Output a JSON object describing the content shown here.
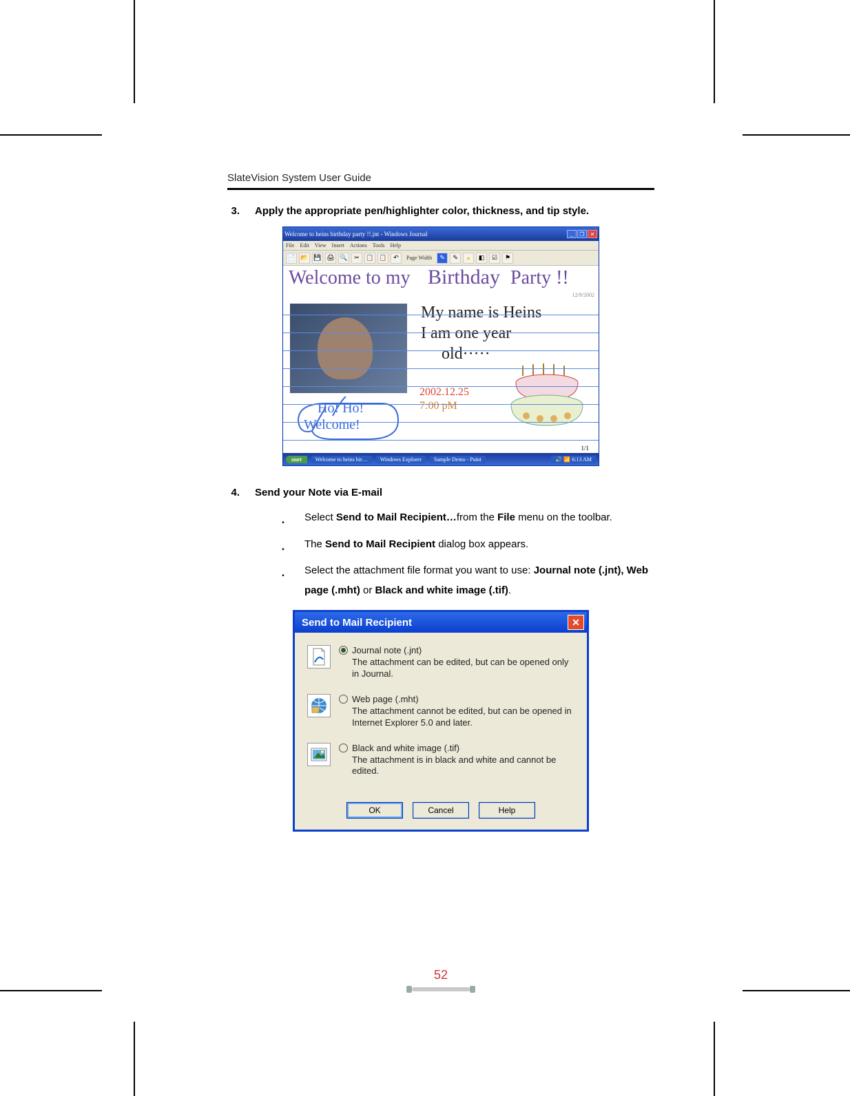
{
  "header": {
    "title": "SlateVision System User Guide"
  },
  "steps": {
    "s3": {
      "num": "3.",
      "text": "Apply the appropriate pen/highlighter color, thickness, and tip style."
    },
    "s4": {
      "num": "4.",
      "text": "Send your Note via E-mail",
      "bullets": {
        "b1": {
          "pre": "Select ",
          "bold1": "Send to Mail Recipient…",
          "mid": "from the ",
          "bold2": "File",
          "post": " menu on the toolbar."
        },
        "b2": {
          "pre": "The ",
          "bold1": "Send to Mail Recipient",
          "post": " dialog box appears."
        },
        "b3": {
          "pre": "Select the attachment file format you want to use: ",
          "bold1": "Journal note (.jnt), Web page (.mht)",
          "mid": " or ",
          "bold2": "Black and white image (.tif)",
          "post": "."
        }
      }
    }
  },
  "journal": {
    "title": "Welcome to heins birthday party !!.jnt - Windows Journal",
    "menus": [
      "File",
      "Edit",
      "View",
      "Insert",
      "Actions",
      "Tools",
      "Help"
    ],
    "toolbar_label": "Page Width",
    "handwriting": {
      "l1": "Welcome to my",
      "l2": "Birthday",
      "l3": "Party !!",
      "l4": "My name is Heins",
      "l5": "I am one year",
      "l6": "old·····",
      "date": "2002.12.25",
      "time": "7:00 pM",
      "bubble1": "Ho! Ho!",
      "bubble2": "Welcome!"
    },
    "date_tag": "12/9/2002",
    "page_ind": "1/1",
    "taskbar": {
      "start": "start",
      "t1": "Welcome to heins bir…",
      "t2": "Windows Explorer",
      "t3": "Sample Demo - Paint",
      "clock": "🔊 📶 6:13 AM"
    }
  },
  "dialog": {
    "title": "Send to Mail Recipient",
    "options": {
      "jnt": {
        "label": "Journal note (.jnt)",
        "desc": "The attachment can be edited, but can be opened only in Journal."
      },
      "mht": {
        "label": "Web page (.mht)",
        "desc": "The attachment cannot be edited, but can be opened in Internet Explorer 5.0 and later."
      },
      "tif": {
        "label": "Black and white image (.tif)",
        "desc": "The attachment is in black and white and cannot be edited."
      }
    },
    "buttons": {
      "ok": "OK",
      "cancel": "Cancel",
      "help": "Help"
    }
  },
  "page_number": "52"
}
